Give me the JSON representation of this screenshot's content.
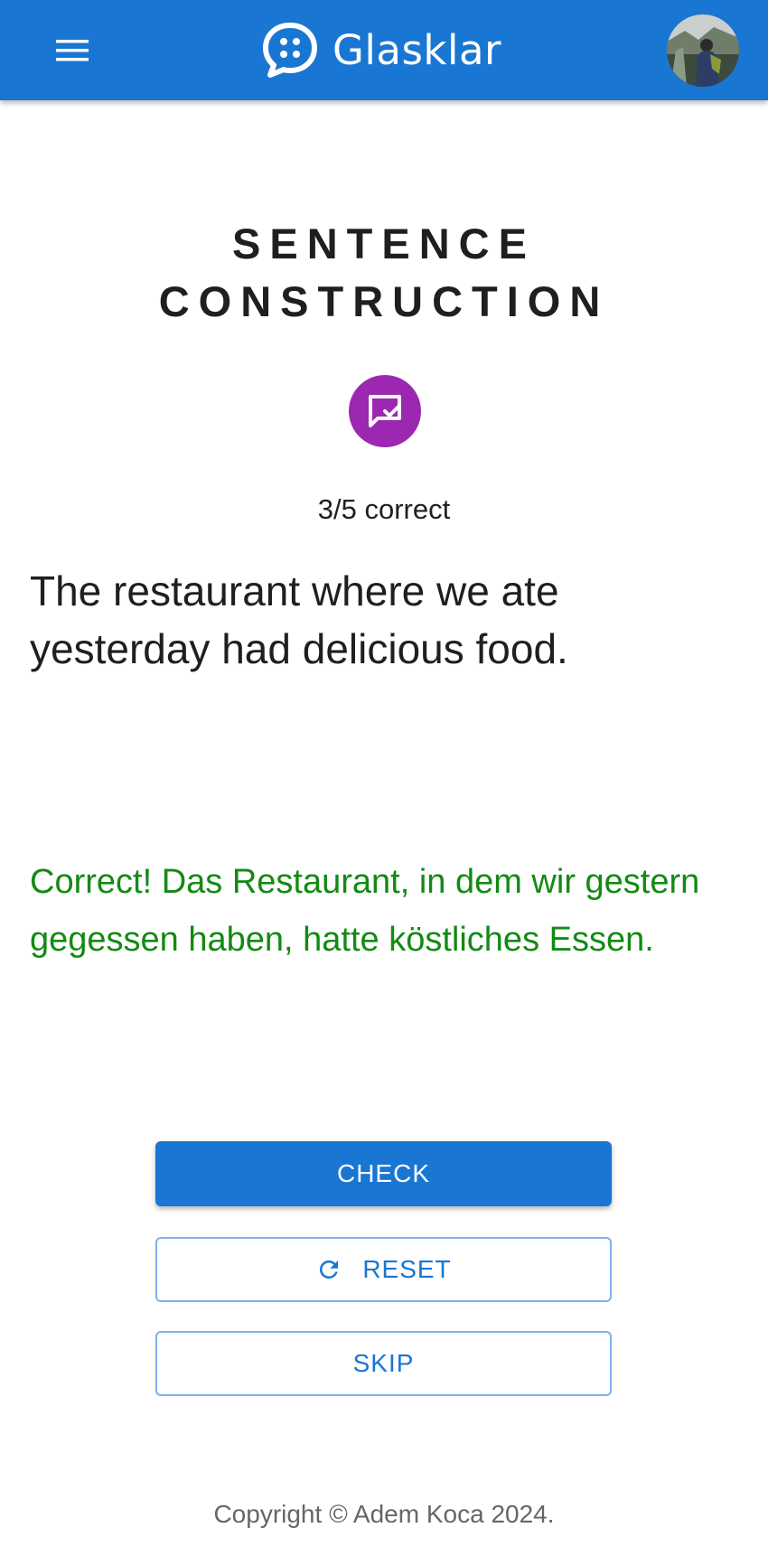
{
  "app": {
    "brand_name": "Glasklar",
    "brand_color": "#1976d2",
    "icons": {
      "menu": "menu-icon",
      "logo": "chat-bubble-logo-icon",
      "avatar": "user-avatar",
      "task": "chat-check-icon",
      "reset": "refresh-icon"
    }
  },
  "exercise": {
    "title": "SENTENCE CONSTRUCTION",
    "icon_color": "#9c27b0",
    "progress_text": "3/5 correct",
    "progress": {
      "correct": 3,
      "total": 5
    },
    "prompt": "The restaurant where we ate yesterday had delicious food.",
    "feedback": "Correct! Das Restaurant, in dem wir gestern gegessen haben, hatte köstliches Essen.",
    "feedback_color": "#138a13"
  },
  "actions": {
    "check_label": "CHECK",
    "reset_label": "RESET",
    "skip_label": "SKIP"
  },
  "footer": {
    "copyright": "Copyright © Adem Koca 2024."
  }
}
